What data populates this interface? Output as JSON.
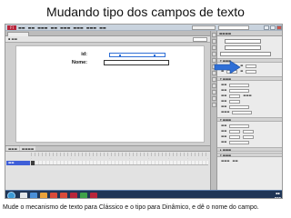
{
  "slide": {
    "title": "Mudando tipo dos campos de texto",
    "caption": "Mude o mecanismo de texto para Clássico e o tipo para Dinâmico, e dê o nome do campo."
  },
  "stage": {
    "label_id": "id:",
    "label_nome": "Nome:"
  },
  "colors": {
    "arrow": "#2f6fd6",
    "taskbar": "#1f3556",
    "selection": "#2f6fd6"
  },
  "icons": {
    "arrow": "arrow-right-icon",
    "start": "windows-start-icon"
  }
}
